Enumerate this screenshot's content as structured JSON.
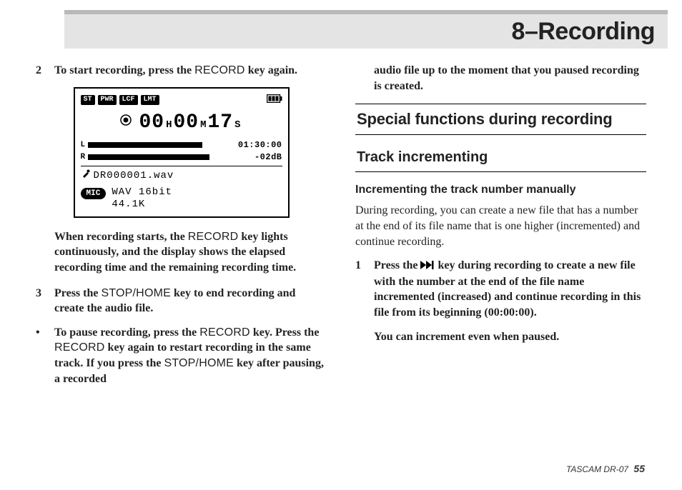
{
  "header": {
    "chapter_title": "8–Recording"
  },
  "left": {
    "step2": {
      "num": "2",
      "text_a": "To start recording, press the ",
      "key1": "RECORD",
      "text_b": " key again."
    },
    "after_lcd": {
      "text_a": "When recording starts, the ",
      "key1": "RECORD",
      "text_b": " key lights continuously, and the display shows the elapsed recording time and the remaining recording time."
    },
    "step3": {
      "num": "3",
      "text_a": "Press the ",
      "key1": "STOP/HOME",
      "text_b": " key to end recording and create the audio file."
    },
    "bullet": {
      "mark": "•",
      "text_a": "To pause recording, press the ",
      "key1": "RECORD",
      "text_b": " key. Press the ",
      "key2": "RECORD",
      "text_c": " key again to restart recording in the same track. If you press the ",
      "key3": "STOP/HOME",
      "text_d": " key after pausing, a recorded"
    }
  },
  "right": {
    "cont": "audio file up to the moment that you paused recording is created.",
    "h2": "Special functions during recording",
    "h3": "Track incrementing",
    "h4": "Incrementing the track number manually",
    "p1": "During recording, you can create a new file that has a number at the end of its file name that is one higher (incremented) and continue recording.",
    "step1": {
      "num": "1",
      "text_a": "Press the ",
      "text_b": " key during recording to create a new file with the number at the end of the file name incremented (increased) and continue recording in this file from its beginning (00:00:00)."
    },
    "p2": "You can increment even when paused."
  },
  "lcd": {
    "tags": {
      "st": "ST",
      "pwr": "PWR",
      "lcf": "LCF",
      "lmt": "LMT"
    },
    "time": {
      "h": "00",
      "h_unit": "H",
      "m": "00",
      "m_unit": "M",
      "s": "17",
      "s_unit": "S"
    },
    "meters": {
      "l": "L",
      "r": "R",
      "remain": "01:30:00",
      "db": "-02dB"
    },
    "filename": "DR000001.wav",
    "mic": "MIC",
    "format_line1": "WAV 16bit",
    "format_line2": "44.1K"
  },
  "footer": {
    "model": "TASCAM  DR-07",
    "page": "55"
  }
}
